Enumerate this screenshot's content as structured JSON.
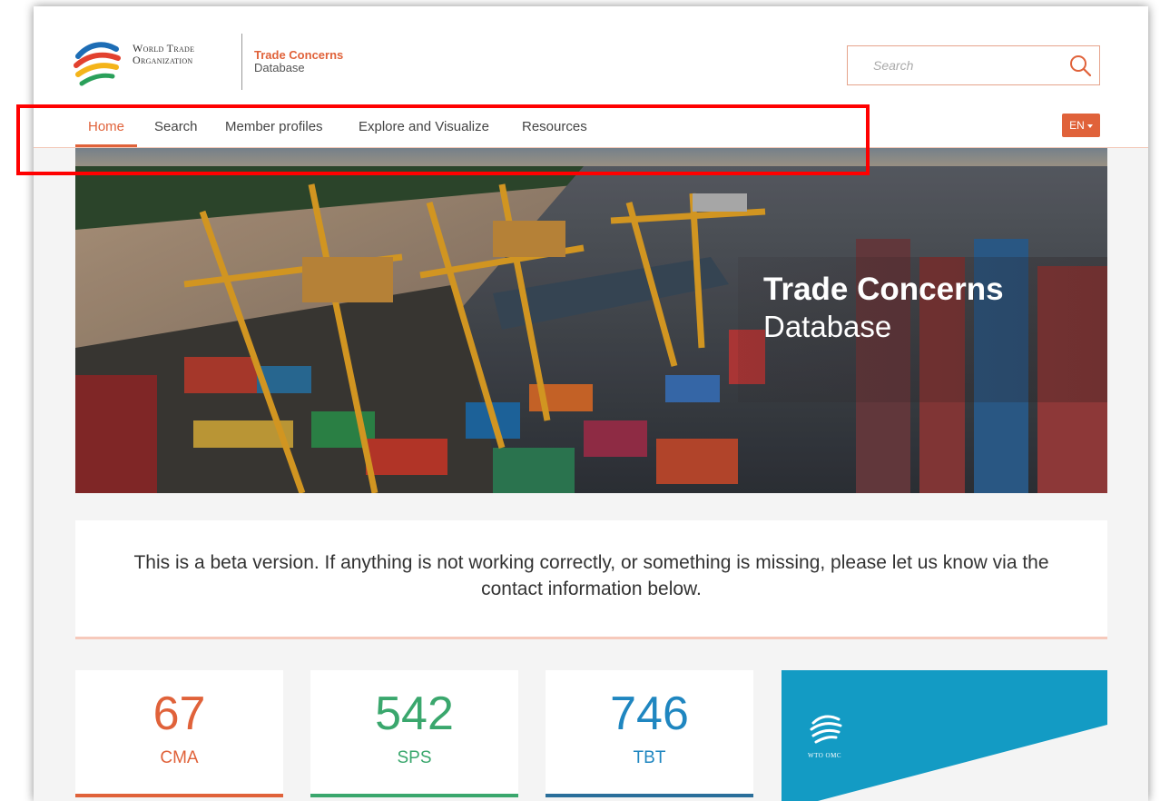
{
  "header": {
    "org_line1": "World Trade",
    "org_line2": "Organization",
    "db_title": "Trade Concerns",
    "db_subtitle": "Database",
    "search_placeholder": "Search"
  },
  "nav": {
    "items": [
      {
        "label": "Home",
        "active": true
      },
      {
        "label": "Search"
      },
      {
        "label": "Member profiles"
      },
      {
        "label": "Explore and Visualize"
      },
      {
        "label": "Resources"
      }
    ],
    "language": "EN"
  },
  "hero": {
    "title": "Trade Concerns",
    "subtitle": "Database"
  },
  "notice": {
    "text": "This is a beta version. If anything is not working correctly, or something is missing, please let us know via the contact information below."
  },
  "stats": [
    {
      "value": "67",
      "label": "CMA",
      "color": "#e0623a"
    },
    {
      "value": "542",
      "label": "SPS",
      "color": "#3aa76d"
    },
    {
      "value": "746",
      "label": "TBT",
      "color": "#1f86c0"
    }
  ],
  "promo": {
    "caption": "WTO OMC",
    "color": "#139bc4"
  },
  "colors": {
    "accent": "#e0623a",
    "highlight": "#ff0000"
  }
}
